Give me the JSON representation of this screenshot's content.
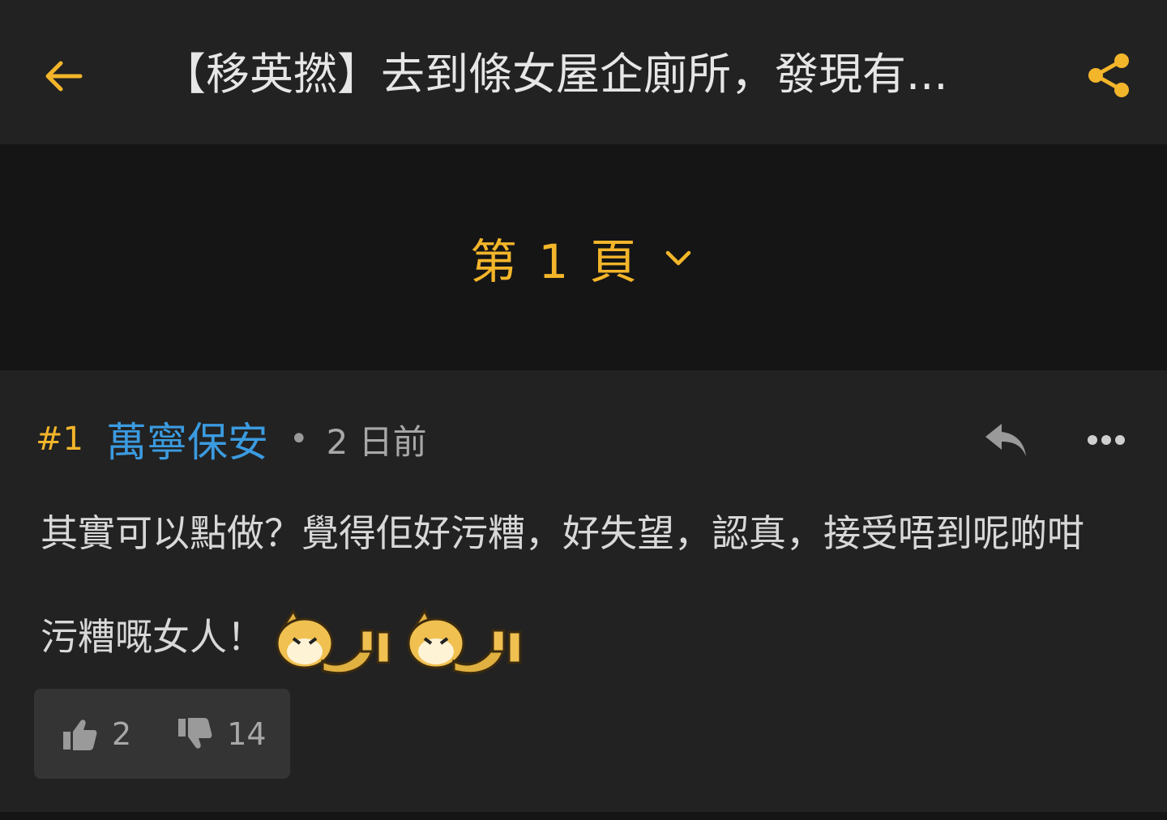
{
  "header": {
    "title": "【移英撚】去到條女屋企廁所，發現有...",
    "back_icon": "arrow-left-icon",
    "share_icon": "share-icon",
    "accent_color": "#f3b52a"
  },
  "pagination": {
    "label": "第 1 頁",
    "dropdown_icon": "chevron-down-icon"
  },
  "post": {
    "number": "#1",
    "author": "萬寧保安",
    "separator": "•",
    "time": "2 日前",
    "author_color": "#3b9be0",
    "reply_icon": "reply-icon",
    "more_icon": "more-dots-icon",
    "body_line1": "其實可以點做？覺得佢好污糟，好失望，認真，接受唔到呢啲咁",
    "body_line2": "污糟嘅女人！",
    "stickers": [
      "dog-sticker",
      "dog-sticker"
    ],
    "likes": "2",
    "dislikes": "14",
    "like_icon": "thumbs-up-icon",
    "dislike_icon": "thumbs-down-icon"
  }
}
